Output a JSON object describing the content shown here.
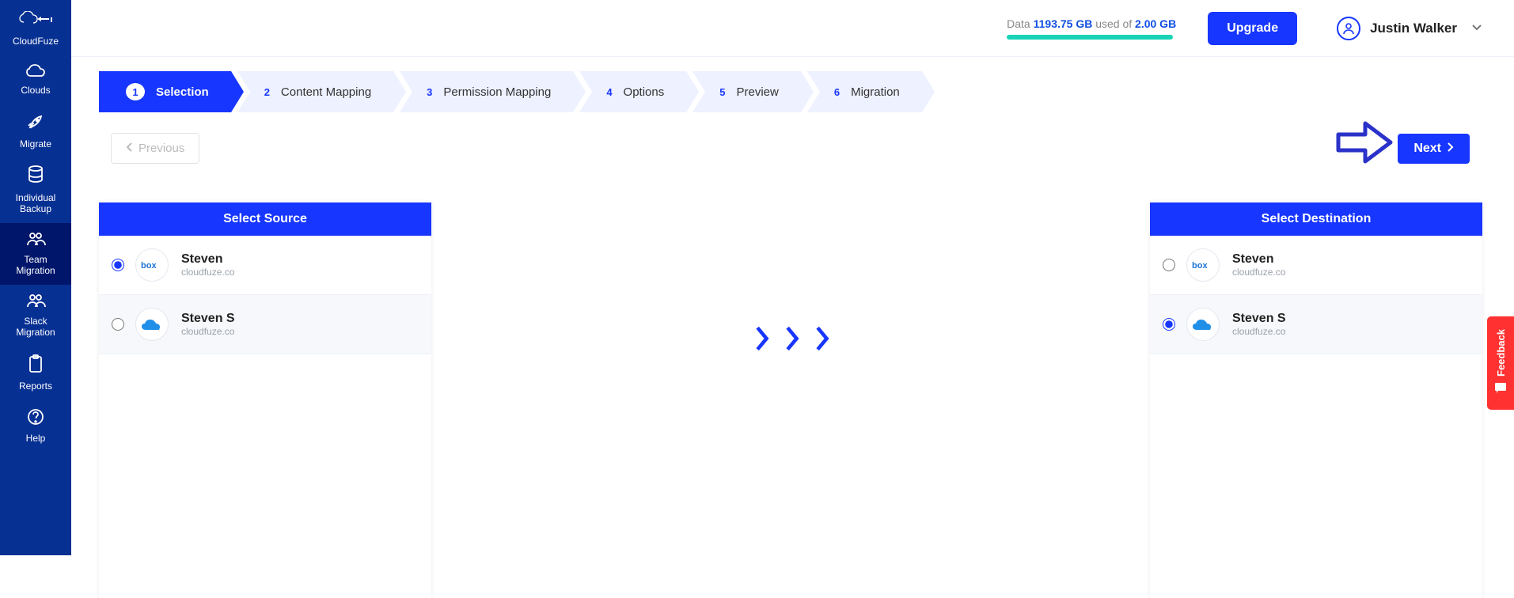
{
  "brand": "CloudFuze",
  "sidebar": {
    "items": [
      {
        "label": "CloudFuze"
      },
      {
        "label": "Clouds"
      },
      {
        "label": "Migrate"
      },
      {
        "label": "Individual Backup"
      },
      {
        "label": "Team Migration"
      },
      {
        "label": "Slack Migration"
      },
      {
        "label": "Reports"
      },
      {
        "label": "Help"
      }
    ]
  },
  "topbar": {
    "data_label": "Data ",
    "used_value": "1193.75 GB",
    "used_mid": " used of ",
    "total_value": "2.00 GB",
    "upgrade": "Upgrade",
    "user": "Justin Walker"
  },
  "steps": [
    {
      "n": "1",
      "label": "Selection"
    },
    {
      "n": "2",
      "label": "Content Mapping"
    },
    {
      "n": "3",
      "label": "Permission Mapping"
    },
    {
      "n": "4",
      "label": "Options"
    },
    {
      "n": "5",
      "label": "Preview"
    },
    {
      "n": "6",
      "label": "Migration"
    }
  ],
  "nav": {
    "prev": "Previous",
    "next": "Next"
  },
  "source_panel": {
    "title": "Select Source",
    "rows": [
      {
        "name": "Steven",
        "domain": "cloudfuze.co",
        "provider": "box",
        "selected": true
      },
      {
        "name": "Steven S",
        "domain": "cloudfuze.co",
        "provider": "onedrive",
        "selected": false
      }
    ]
  },
  "dest_panel": {
    "title": "Select Destination",
    "rows": [
      {
        "name": "Steven",
        "domain": "cloudfuze.co",
        "provider": "box",
        "selected": false
      },
      {
        "name": "Steven S",
        "domain": "cloudfuze.co",
        "provider": "onedrive",
        "selected": true
      }
    ]
  },
  "feedback": "Feedback"
}
